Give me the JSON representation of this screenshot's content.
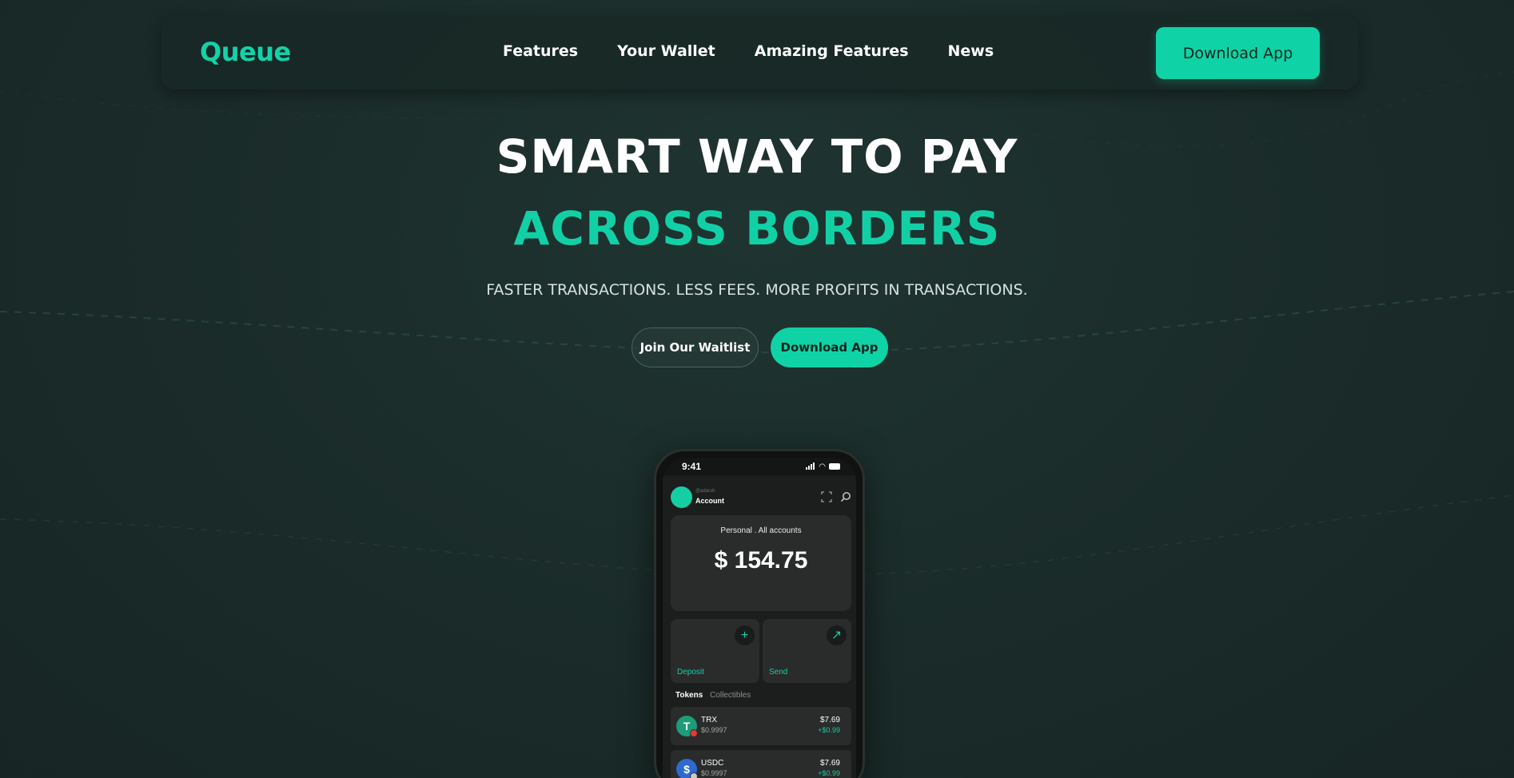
{
  "brand": {
    "logo": "Queue",
    "accent": "#0fd3a6"
  },
  "nav": {
    "links": [
      "Features",
      "Your Wallet",
      "Amazing Features",
      "News"
    ],
    "cta": "Download App"
  },
  "hero": {
    "title_line1": "SMART WAY TO PAY",
    "title_line2": "ACROSS BORDERS",
    "subtitle": "FASTER TRANSACTIONS. LESS FEES. MORE PROFITS IN TRANSACTIONS.",
    "primary_button": "Join Our Waitlist",
    "secondary_button": "Download App"
  },
  "phone": {
    "time": "9:41",
    "account": {
      "handle": "@adarsh",
      "label": "Account"
    },
    "balance": {
      "label": "Personal . All accounts",
      "value": "$ 154.75"
    },
    "actions": [
      {
        "label": "Deposit",
        "icon": "plus-icon"
      },
      {
        "label": "Send",
        "icon": "arrow-up-right-icon"
      }
    ],
    "tabs": [
      "Tokens",
      "Collectibles"
    ],
    "tokens": [
      {
        "name": "TRX",
        "price": "$0.9997",
        "value": "$7.69",
        "change": "+$0.99",
        "icon": "T"
      },
      {
        "name": "USDC",
        "price": "$0.9997",
        "value": "$7.69",
        "change": "+$0.99",
        "icon": "$"
      }
    ]
  }
}
